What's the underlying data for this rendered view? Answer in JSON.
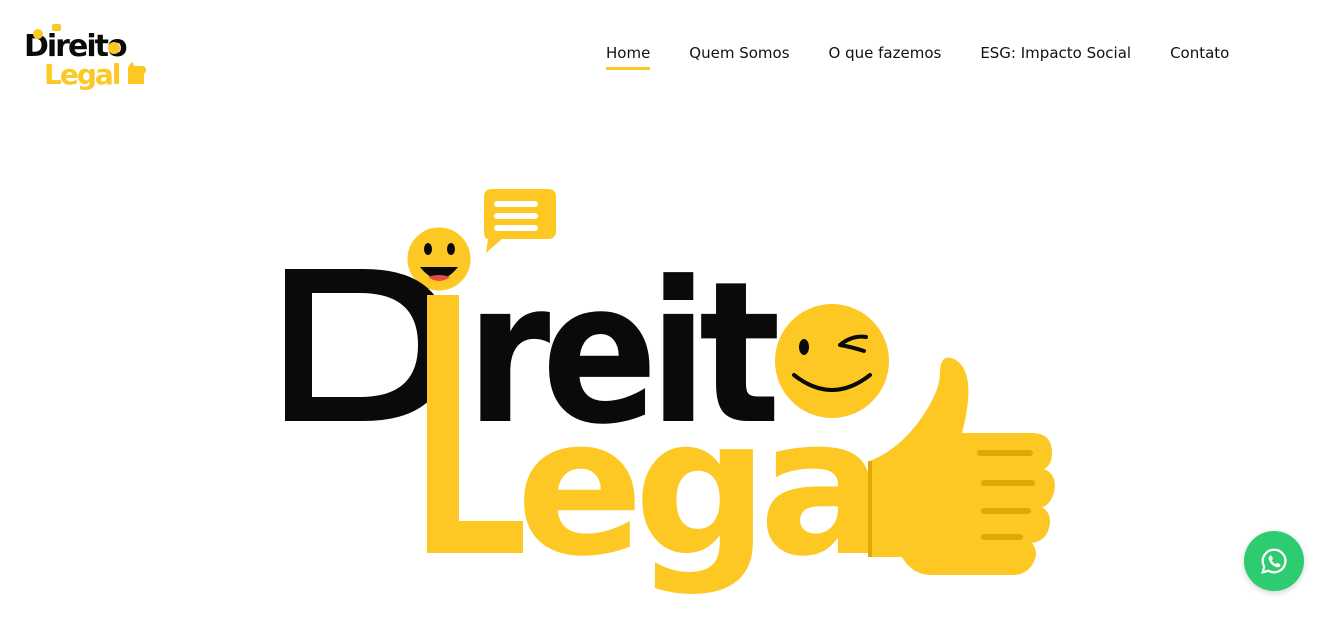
{
  "brand": {
    "logo_line1": "Direito",
    "logo_line2": "Legal"
  },
  "nav": {
    "items": [
      {
        "label": "Home",
        "active": true
      },
      {
        "label": "Quem Somos",
        "active": false
      },
      {
        "label": "O que fazemos",
        "active": false
      },
      {
        "label": "ESG: Impacto Social",
        "active": false
      },
      {
        "label": "Contato",
        "active": false
      }
    ]
  },
  "colors": {
    "accent": "#fdc824",
    "text": "#0a0a0a",
    "whatsapp": "#2ecc71"
  },
  "icons": {
    "whatsapp": "whatsapp-icon",
    "smiley": "laughing-emoji-icon",
    "wink": "winking-emoji-icon",
    "thumb": "thumbs-up-icon",
    "chat": "chat-bubble-icon"
  }
}
